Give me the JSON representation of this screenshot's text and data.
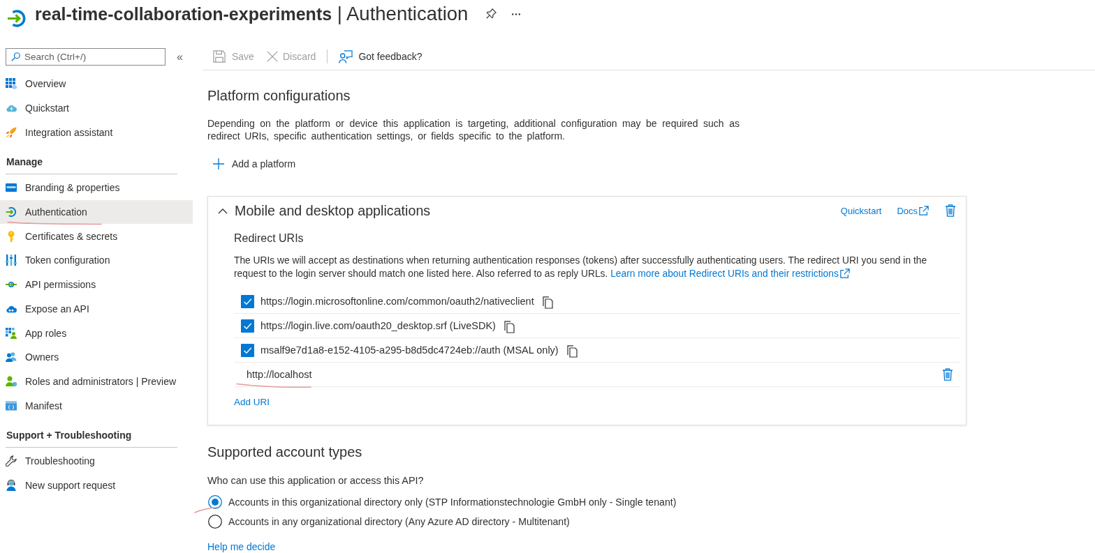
{
  "header": {
    "title": "**real-time-collaboration-experiments** | Authentication"
  },
  "sidebar": {
    "search": {
      "placeholder": "Search (Ctrl+/)"
    },
    "collapse": "«",
    "sections": [
      {
        "items": [
          {
            "label": "Overview",
            "selected": false,
            "underlined": false
          },
          {
            "label": "Quickstart",
            "selected": false,
            "underlined": false
          },
          {
            "label": "Integration assistant",
            "selected": false,
            "underlined": false
          }
        ]
      },
      {
        "title": "Manage",
        "items": [
          {
            "label": "Branding & properties",
            "selected": false,
            "underlined": false
          },
          {
            "label": "Authentication",
            "selected": true,
            "underlined": true
          },
          {
            "label": "Certificates & secrets",
            "selected": false,
            "underlined": false
          },
          {
            "label": "Token configuration",
            "selected": false,
            "underlined": false
          },
          {
            "label": "API permissions",
            "selected": false,
            "underlined": false
          },
          {
            "label": "Expose an API",
            "selected": false,
            "underlined": false
          },
          {
            "label": "App roles",
            "selected": false,
            "underlined": false
          },
          {
            "label": "Owners",
            "selected": false,
            "underlined": false
          },
          {
            "label": "Roles and administrators | Preview",
            "selected": false,
            "underlined": false
          },
          {
            "label": "Manifest",
            "selected": false,
            "underlined": false
          }
        ]
      },
      {
        "title": "Support + Troubleshooting",
        "items": [
          {
            "label": "Troubleshooting",
            "selected": false,
            "underlined": false
          },
          {
            "label": "New support request",
            "selected": false,
            "underlined": false
          }
        ]
      }
    ]
  },
  "toolbar": [
    {
      "label": "Save",
      "disabled": true
    },
    {
      "label": "Discard",
      "disabled": true
    },
    {
      "label": "Got feedback?",
      "disabled": false
    }
  ],
  "platforms": {
    "title": "Platform configurations",
    "description": "Depending on the platform or device this application is targeting, additional configuration may be required such as redirect URIs, specific authentication settings, or fields specific to the platform.",
    "add_button": "Add a platform",
    "cards": [
      {
        "title": "Mobile and desktop applications",
        "expanded": true,
        "links": [
          {
            "label": "Quickstart",
            "external": false
          },
          {
            "label": "Docs",
            "external": true
          }
        ],
        "redirect": {
          "title": "Redirect URIs",
          "description": "The URIs we will accept as destinations when returning authentication responses (tokens) after successfully authenticating users. The redirect URI you send in the request to the login server should match one listed here. Also referred to as reply URLs.",
          "link": "Learn more about Redirect URIs and their restrictions",
          "uris": [
            {
              "kind": "suggested",
              "value": "https://login.microsoftonline.com/common/oauth2/nativeclient",
              "checked": true,
              "underlined": false
            },
            {
              "kind": "suggested",
              "value": "https://login.live.com/oauth20_desktop.srf (LiveSDK)",
              "checked": true,
              "underlined": false
            },
            {
              "kind": "suggested",
              "value": "msalf9e7d1a8-e152-4105-a295-b8d5dc4724eb://auth (MSAL only)",
              "checked": true,
              "underlined": false
            },
            {
              "kind": "custom",
              "value": "http://localhost",
              "underlined": true
            }
          ],
          "add_button": "Add URI"
        }
      }
    ]
  },
  "accounts": {
    "title": "Supported account types",
    "question": "Who can use this application or access this API?",
    "options": [
      {
        "label": "Accounts in this organizational directory only (STP Informationstechnologie GmbH only - Single tenant)",
        "selected": true,
        "underlined": true
      },
      {
        "label": "Accounts in any organizational directory (Any Azure AD directory - Multitenant)",
        "selected": false,
        "underlined": false
      }
    ],
    "help_link": "Help me decide"
  }
}
